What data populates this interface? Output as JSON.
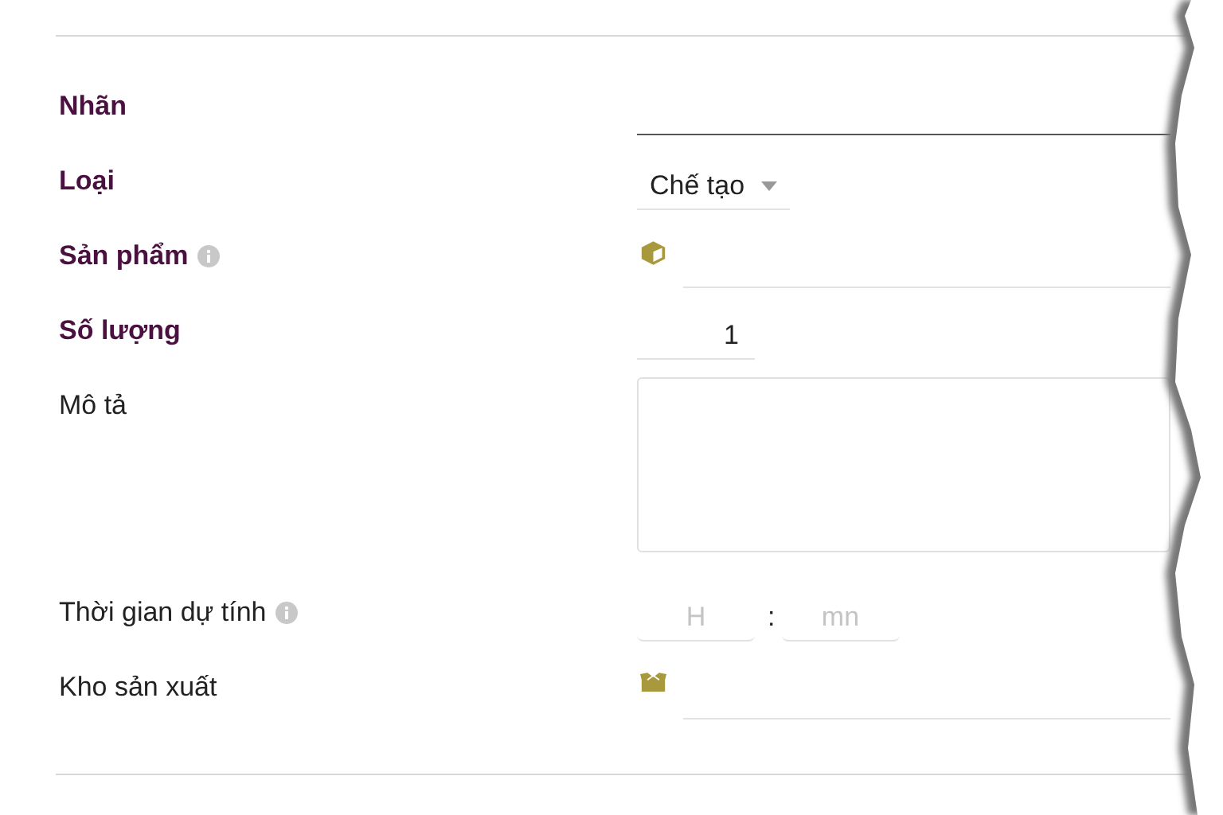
{
  "fields": [
    {
      "label": "Nhãn",
      "required": true,
      "help": false,
      "kind": "text",
      "focused": true
    },
    {
      "label": "Loại",
      "required": true,
      "help": false,
      "kind": "select",
      "value": "Chế tạo"
    },
    {
      "label": "Sản phẩm",
      "required": true,
      "help": true,
      "kind": "product"
    },
    {
      "label": "Số lượng",
      "required": true,
      "help": false,
      "kind": "number",
      "value": "1"
    },
    {
      "label": "Mô tả",
      "required": false,
      "help": false,
      "kind": "textarea"
    },
    {
      "label": "Thời gian dự tính",
      "required": false,
      "help": true,
      "kind": "duration",
      "hours_placeholder": "H",
      "separator": ":",
      "minutes_placeholder": "mn"
    },
    {
      "label": "Kho sản xuất",
      "required": false,
      "help": false,
      "kind": "warehouse"
    }
  ]
}
